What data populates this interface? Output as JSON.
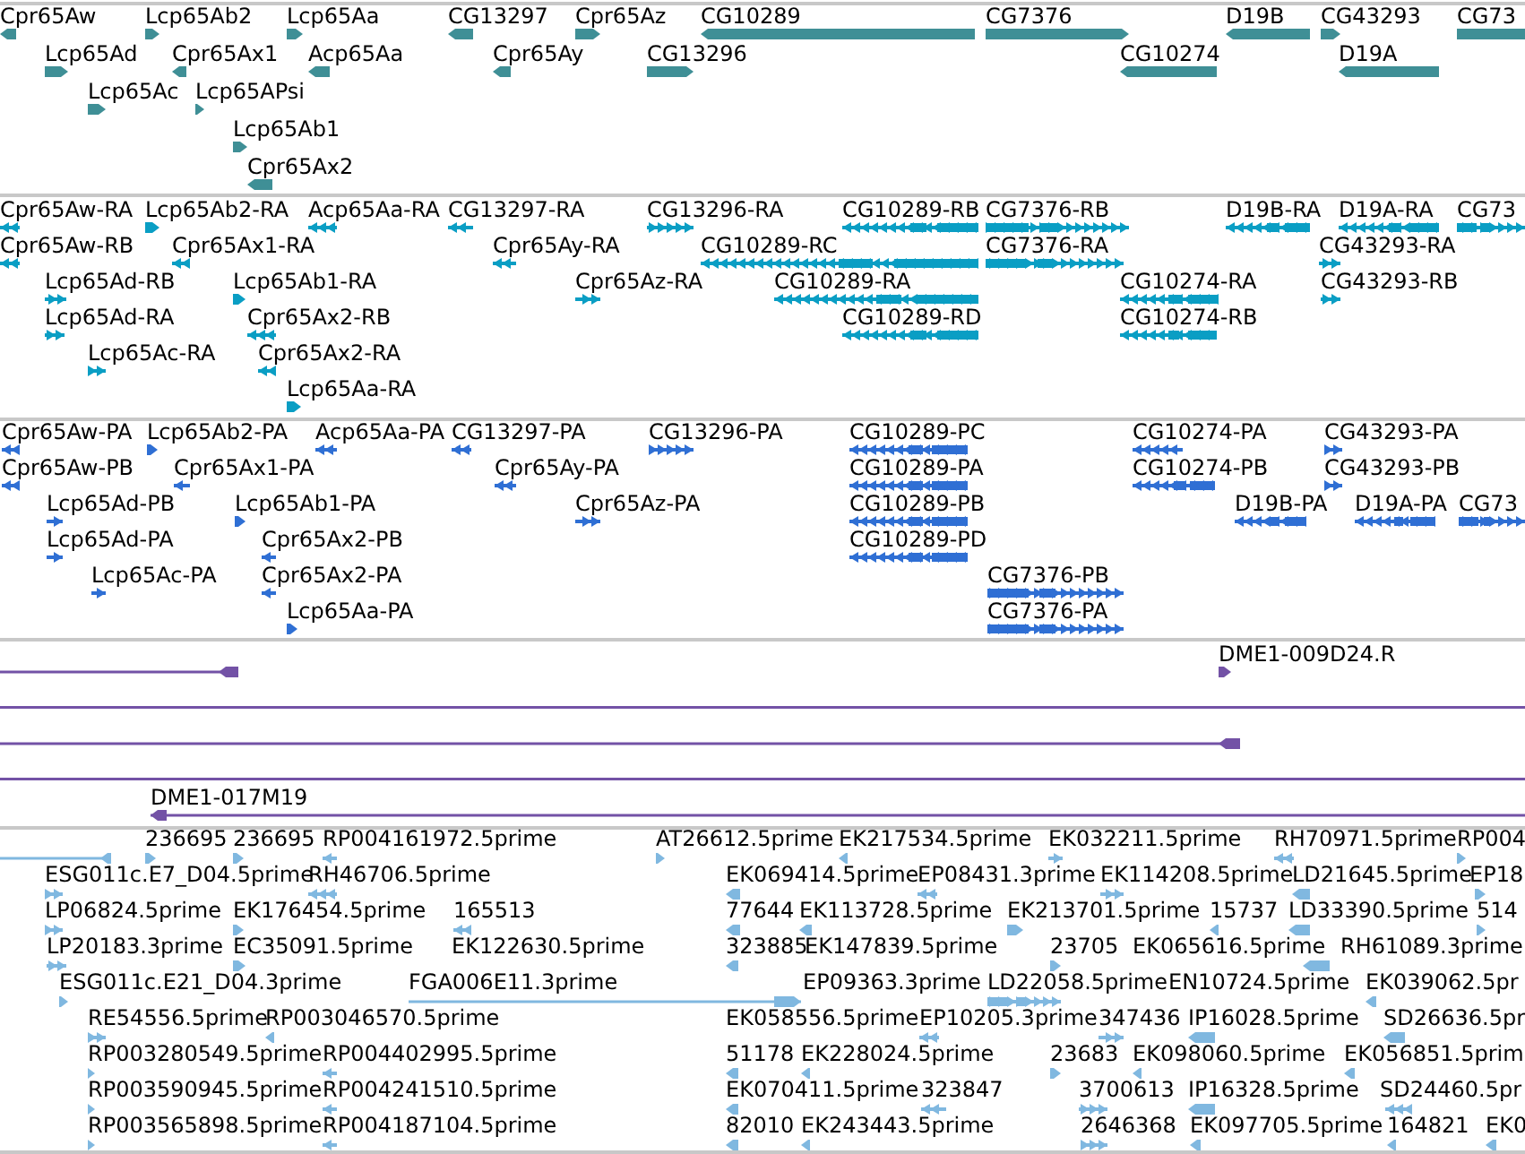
{
  "tracks": [
    {
      "color": "#3f8f96",
      "features": [
        {
          "label": "Cpr65Aw",
          "kind": "block",
          "reverse": true
        },
        {
          "label": "Lcp65Ab2",
          "kind": "block",
          "reverse": false
        },
        {
          "label": "Lcp65Aa",
          "kind": "block",
          "reverse": false
        },
        {
          "label": "CG13297",
          "kind": "block",
          "reverse": true
        },
        {
          "label": "Cpr65Az",
          "kind": "block",
          "reverse": false
        },
        {
          "label": "CG10289",
          "kind": "block",
          "reverse": true
        },
        {
          "label": "CG7376",
          "kind": "block",
          "reverse": false
        },
        {
          "label": "D19B",
          "kind": "block",
          "reverse": true
        },
        {
          "label": "CG43293",
          "kind": "block",
          "reverse": false
        },
        {
          "label": "CG73",
          "kind": "block"
        },
        {
          "label": "Lcp65Ad",
          "kind": "block",
          "reverse": false
        },
        {
          "label": "Cpr65Ax1",
          "kind": "block",
          "reverse": true
        },
        {
          "label": "Acp65Aa",
          "kind": "block",
          "reverse": true
        },
        {
          "label": "Cpr65Ay",
          "kind": "block",
          "reverse": true
        },
        {
          "label": "CG13296",
          "kind": "block",
          "reverse": false
        },
        {
          "label": "CG10274",
          "kind": "block",
          "reverse": true
        },
        {
          "label": "D19A",
          "kind": "block",
          "reverse": true
        },
        {
          "label": "Lcp65Ac",
          "kind": "block",
          "reverse": false
        },
        {
          "label": "Lcp65APsi",
          "kind": "block",
          "reverse": false
        },
        {
          "label": "Lcp65Ab1",
          "kind": "block",
          "reverse": false
        },
        {
          "label": "Cpr65Ax2",
          "kind": "block",
          "reverse": true
        }
      ]
    },
    {
      "color": "#0a9ec4",
      "features": [
        {
          "label": "Cpr65Aw-RA",
          "kind": "exons",
          "reverse": true
        },
        {
          "label": "Lcp65Ab2-RA",
          "kind": "block",
          "reverse": false
        },
        {
          "label": "Acp65Aa-RA",
          "kind": "exons",
          "reverse": true
        },
        {
          "label": "CG13297-RA",
          "kind": "exons",
          "reverse": true
        },
        {
          "label": "CG13296-RA",
          "kind": "exons",
          "reverse": false
        },
        {
          "label": "CG10289-RB",
          "kind": "exons",
          "reverse": true
        },
        {
          "label": "CG7376-RB",
          "kind": "exons",
          "reverse": false
        },
        {
          "label": "D19B-RA",
          "kind": "exons",
          "reverse": true
        },
        {
          "label": "D19A-RA",
          "kind": "exons",
          "reverse": true
        },
        {
          "label": "CG73",
          "kind": "exons",
          "reverse": false
        },
        {
          "label": "Cpr65Aw-RB",
          "kind": "exons",
          "reverse": true
        },
        {
          "label": "Cpr65Ax1-RA",
          "kind": "exons",
          "reverse": true
        },
        {
          "label": "Cpr65Ay-RA",
          "kind": "exons",
          "reverse": true
        },
        {
          "label": "CG10289-RC",
          "kind": "exons",
          "reverse": true
        },
        {
          "label": "CG7376-RA",
          "kind": "exons",
          "reverse": false
        },
        {
          "label": "CG43293-RA",
          "kind": "exons",
          "reverse": false
        },
        {
          "label": "Lcp65Ad-RB",
          "kind": "exons",
          "reverse": false
        },
        {
          "label": "Lcp65Ab1-RA",
          "kind": "block",
          "reverse": false
        },
        {
          "label": "Cpr65Az-RA",
          "kind": "exons",
          "reverse": false
        },
        {
          "label": "CG10289-RA",
          "kind": "exons",
          "reverse": true
        },
        {
          "label": "CG10274-RA",
          "kind": "exons",
          "reverse": true
        },
        {
          "label": "CG43293-RB",
          "kind": "exons",
          "reverse": false
        },
        {
          "label": "Lcp65Ad-RA",
          "kind": "exons",
          "reverse": false
        },
        {
          "label": "Cpr65Ax2-RB",
          "kind": "exons",
          "reverse": true
        },
        {
          "label": "CG10289-RD",
          "kind": "exons",
          "reverse": true
        },
        {
          "label": "CG10274-RB",
          "kind": "exons",
          "reverse": true
        },
        {
          "label": "Lcp65Ac-RA",
          "kind": "exons",
          "reverse": false
        },
        {
          "label": "Cpr65Ax2-RA",
          "kind": "exons",
          "reverse": true
        },
        {
          "label": "Lcp65Aa-RA",
          "kind": "block",
          "reverse": false
        }
      ]
    },
    {
      "color": "#2f6fd4",
      "features": [
        {
          "label": "Cpr65Aw-PA",
          "kind": "exons",
          "reverse": true
        },
        {
          "label": "Lcp65Ab2-PA",
          "kind": "block",
          "reverse": false
        },
        {
          "label": "Acp65Aa-PA",
          "kind": "exons",
          "reverse": true
        },
        {
          "label": "CG13297-PA",
          "kind": "exons",
          "reverse": true
        },
        {
          "label": "CG13296-PA",
          "kind": "exons",
          "reverse": false
        },
        {
          "label": "CG10289-PC",
          "kind": "exons",
          "reverse": true
        },
        {
          "label": "CG10274-PA",
          "kind": "exons",
          "reverse": true
        },
        {
          "label": "CG43293-PA",
          "kind": "exons",
          "reverse": false
        },
        {
          "label": "Cpr65Aw-PB",
          "kind": "exons",
          "reverse": true
        },
        {
          "label": "Cpr65Ax1-PA",
          "kind": "exons",
          "reverse": true
        },
        {
          "label": "Cpr65Ay-PA",
          "kind": "exons",
          "reverse": true
        },
        {
          "label": "CG10289-PA",
          "kind": "exons",
          "reverse": true
        },
        {
          "label": "CG10274-PB",
          "kind": "exons",
          "reverse": true
        },
        {
          "label": "CG43293-PB",
          "kind": "exons",
          "reverse": false
        },
        {
          "label": "Lcp65Ad-PB",
          "kind": "exons",
          "reverse": false
        },
        {
          "label": "Lcp65Ab1-PA",
          "kind": "block",
          "reverse": false
        },
        {
          "label": "Cpr65Az-PA",
          "kind": "exons",
          "reverse": false
        },
        {
          "label": "CG10289-PB",
          "kind": "exons",
          "reverse": true
        },
        {
          "label": "D19B-PA",
          "kind": "exons",
          "reverse": true
        },
        {
          "label": "D19A-PA",
          "kind": "exons",
          "reverse": true
        },
        {
          "label": "CG73",
          "kind": "exons",
          "reverse": false
        },
        {
          "label": "Lcp65Ad-PA",
          "kind": "exons",
          "reverse": false
        },
        {
          "label": "Cpr65Ax2-PB",
          "kind": "exons",
          "reverse": true
        },
        {
          "label": "CG10289-PD",
          "kind": "exons",
          "reverse": true
        },
        {
          "label": "Lcp65Ac-PA",
          "kind": "exons",
          "reverse": false
        },
        {
          "label": "Cpr65Ax2-PA",
          "kind": "exons",
          "reverse": true
        },
        {
          "label": "CG7376-PB",
          "kind": "exons",
          "reverse": false
        },
        {
          "label": "Lcp65Aa-PA",
          "kind": "block",
          "reverse": false
        },
        {
          "label": "CG7376-PA",
          "kind": "exons",
          "reverse": false
        }
      ]
    },
    {
      "color": "#7352a6",
      "features": [
        {
          "kind": "line",
          "reverse": true
        },
        {
          "label": "DME1-009D24.R",
          "kind": "block",
          "reverse": false
        },
        {
          "kind": "line"
        },
        {
          "kind": "line",
          "reverse": true
        },
        {
          "kind": "line"
        },
        {
          "label": "DME1-017M19",
          "kind": "line",
          "reverse": true
        }
      ]
    },
    {
      "color": "#80b8e0",
      "features": [
        {
          "kind": "line",
          "reverse": true
        },
        {
          "label": "236695",
          "kind": "block",
          "reverse": false
        },
        {
          "label": "236695",
          "kind": "block",
          "reverse": false
        },
        {
          "label": "RP004161972.5prime",
          "kind": "exons",
          "reverse": true
        },
        {
          "label": "AT26612.5prime",
          "kind": "block",
          "reverse": false
        },
        {
          "label": "EK217534.5prime",
          "kind": "block",
          "reverse": true
        },
        {
          "label": "EK032211.5prime",
          "kind": "exons",
          "reverse": false
        },
        {
          "label": "RH70971.5prime",
          "kind": "exons",
          "reverse": true
        },
        {
          "label": "RP004",
          "kind": "block",
          "reverse": false
        },
        {
          "label": "ESG011c.E7_D04.5prime",
          "kind": "exons",
          "reverse": false
        },
        {
          "label": "RH46706.5prime",
          "kind": "exons",
          "reverse": true
        },
        {
          "label": "EK069414.5prime",
          "kind": "block",
          "reverse": true
        },
        {
          "label": "EP08431.3prime",
          "kind": "exons",
          "reverse": true
        },
        {
          "label": "EK114208.5prime",
          "kind": "exons",
          "reverse": false
        },
        {
          "label": "LD21645.5prime",
          "kind": "block",
          "reverse": true
        },
        {
          "label": "EP18",
          "kind": "block",
          "reverse": false
        },
        {
          "label": "LP06824.5prime",
          "kind": "exons",
          "reverse": false
        },
        {
          "label": "EK176454.5prime",
          "kind": "block",
          "reverse": false
        },
        {
          "label": "165513",
          "kind": "exons",
          "reverse": true
        },
        {
          "label": "77644",
          "kind": "block",
          "reverse": true
        },
        {
          "label": "EK113728.5prime",
          "kind": "block",
          "reverse": true
        },
        {
          "label": "EK213701.5prime",
          "kind": "block",
          "reverse": false
        },
        {
          "label": "15737",
          "kind": "block",
          "reverse": true
        },
        {
          "label": "LD33390.5prime",
          "kind": "block",
          "reverse": true
        },
        {
          "label": "514",
          "kind": "block",
          "reverse": false
        },
        {
          "label": "LP20183.3prime",
          "kind": "exons",
          "reverse": false
        },
        {
          "label": "EC35091.5prime",
          "kind": "block",
          "reverse": false
        },
        {
          "label": "EK122630.5prime"
        },
        {
          "label": "323885",
          "kind": "block",
          "reverse": true
        },
        {
          "label": "EK147839.5prime"
        },
        {
          "label": "23705",
          "kind": "block",
          "reverse": false
        },
        {
          "label": "EK065616.5prime"
        },
        {
          "kind": "block",
          "reverse": true
        },
        {
          "label": "RH61089.3prime"
        },
        {
          "label": "ESG011c.E21_D04.3prime",
          "kind": "block",
          "reverse": false
        },
        {
          "label": "FGA006E11.3prime",
          "kind": "line",
          "reverse": false
        },
        {
          "label": "EP09363.3prime"
        },
        {
          "label": "LD22058.5prime",
          "kind": "exons",
          "reverse": false
        },
        {
          "label": "EN10724.5prime"
        },
        {
          "label": "EK039062.5pr",
          "kind": "block",
          "reverse": true
        },
        {
          "label": "RE54556.5prime",
          "kind": "exons",
          "reverse": false
        },
        {
          "label": "RP003046570.5prime",
          "kind": "block",
          "reverse": true
        },
        {
          "label": "EK058556.5prime"
        },
        {
          "label": "EP10205.3prime",
          "kind": "exons",
          "reverse": true
        },
        {
          "label": "347436",
          "kind": "exons",
          "reverse": false
        },
        {
          "label": "IP16028.5prime",
          "kind": "block",
          "reverse": true
        },
        {
          "label": "SD26636.5pr",
          "kind": "block",
          "reverse": true
        },
        {
          "label": "RP003280549.5prime",
          "kind": "block",
          "reverse": false
        },
        {
          "label": "RP004402995.5prime",
          "kind": "exons",
          "reverse": true
        },
        {
          "label": "51178",
          "kind": "block",
          "reverse": true
        },
        {
          "label": "EK228024.5prime",
          "kind": "block",
          "reverse": true
        },
        {
          "label": "23683",
          "kind": "block",
          "reverse": false
        },
        {
          "label": "EK098060.5prime",
          "kind": "block",
          "reverse": true
        },
        {
          "label": "EK056851.5prim",
          "kind": "block",
          "reverse": true
        },
        {
          "label": "RP003590945.5prime",
          "kind": "block",
          "reverse": false
        },
        {
          "label": "RP004241510.5prime",
          "kind": "exons",
          "reverse": true
        },
        {
          "label": "EK070411.5prime",
          "kind": "block",
          "reverse": true
        },
        {
          "label": "323847",
          "kind": "exons",
          "reverse": true
        },
        {
          "label": "3700613",
          "kind": "exons",
          "reverse": false
        },
        {
          "label": "IP16328.5prime",
          "kind": "block",
          "reverse": true
        },
        {
          "label": "SD24460.5pr",
          "kind": "exons",
          "reverse": true
        },
        {
          "label": "RP003565898.5prime",
          "kind": "block",
          "reverse": false
        },
        {
          "label": "RP004187104.5prime",
          "kind": "exons",
          "reverse": true
        },
        {
          "label": "82010",
          "kind": "block",
          "reverse": true
        },
        {
          "label": "EK243443.5prime",
          "kind": "block",
          "reverse": true
        },
        {
          "label": "2646368",
          "kind": "exons",
          "reverse": false
        },
        {
          "label": "EK097705.5prime",
          "kind": "block",
          "reverse": true
        },
        {
          "label": "164821",
          "kind": "block",
          "reverse": true
        },
        {
          "label": "EK0",
          "kind": "block",
          "reverse": true
        }
      ]
    }
  ]
}
